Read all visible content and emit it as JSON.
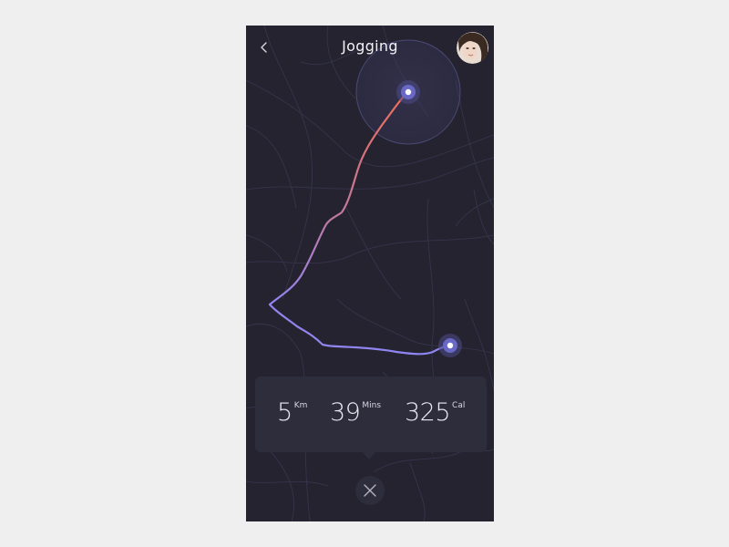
{
  "header": {
    "title": "Jogging",
    "back_icon": "chevron-left-icon",
    "close_icon": "close-icon"
  },
  "stats": [
    {
      "value": "5",
      "unit": "Km"
    },
    {
      "value": "39",
      "unit": "Mins"
    },
    {
      "value": "325",
      "unit": "Cal"
    }
  ],
  "colors": {
    "background": "#efefef",
    "phone_bg": "#24232f",
    "card_bg": "#2e2d3c",
    "route_start": "#e86a5a",
    "route_end": "#8f85f0",
    "marker": "#6a68c7"
  }
}
